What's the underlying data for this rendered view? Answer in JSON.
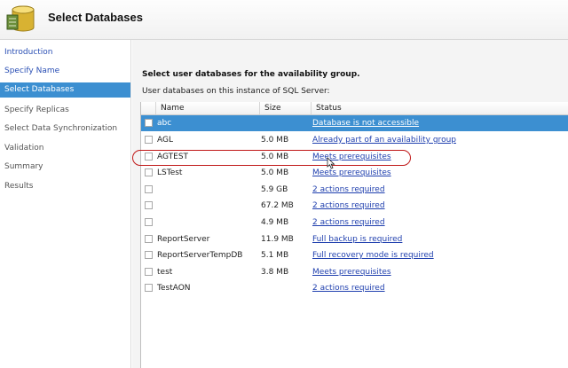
{
  "header": {
    "title": "Select Databases",
    "logo_icon": "database-wizard-icon"
  },
  "sidebar": {
    "items": [
      {
        "label": "Introduction",
        "state": "link"
      },
      {
        "label": "Specify Name",
        "state": "link"
      },
      {
        "label": "Select Databases",
        "state": "active"
      },
      {
        "label": "Specify Replicas",
        "state": "disabled"
      },
      {
        "label": "Select Data Synchronization",
        "state": "disabled"
      },
      {
        "label": "Validation",
        "state": "disabled"
      },
      {
        "label": "Summary",
        "state": "disabled"
      },
      {
        "label": "Results",
        "state": "disabled"
      }
    ]
  },
  "main": {
    "instruction": "Select user databases for the availability group.",
    "sublabel": "User databases on this instance of SQL Server:",
    "columns": [
      "Name",
      "Size",
      "Status"
    ],
    "rows": [
      {
        "name": "abc",
        "size": "",
        "status": "Database is not accessible",
        "selected": true
      },
      {
        "name": "AGL",
        "size": "5.0 MB",
        "status": "Already part of an availability group"
      },
      {
        "name": "AGTEST",
        "size": "5.0 MB",
        "status": "Meets prerequisites"
      },
      {
        "name": "LSTest",
        "size": "5.0 MB",
        "status": "Meets prerequisites"
      },
      {
        "name": "",
        "size": "5.9 GB",
        "status": "2 actions required"
      },
      {
        "name": "",
        "size": "67.2 MB",
        "status": "2 actions required"
      },
      {
        "name": "",
        "size": "4.9 MB",
        "status": "2 actions required"
      },
      {
        "name": "ReportServer",
        "size": "11.9 MB",
        "status": "Full backup is required"
      },
      {
        "name": "ReportServerTempDB",
        "size": "5.1 MB",
        "status": "Full recovery mode is required"
      },
      {
        "name": "test",
        "size": "3.8 MB",
        "status": "Meets prerequisites"
      },
      {
        "name": "TestAON",
        "size": "",
        "status": "2 actions required"
      }
    ]
  },
  "colors": {
    "accent": "#3c8fd1",
    "link": "#1f3fae",
    "highlight_ring": "#c01818"
  }
}
